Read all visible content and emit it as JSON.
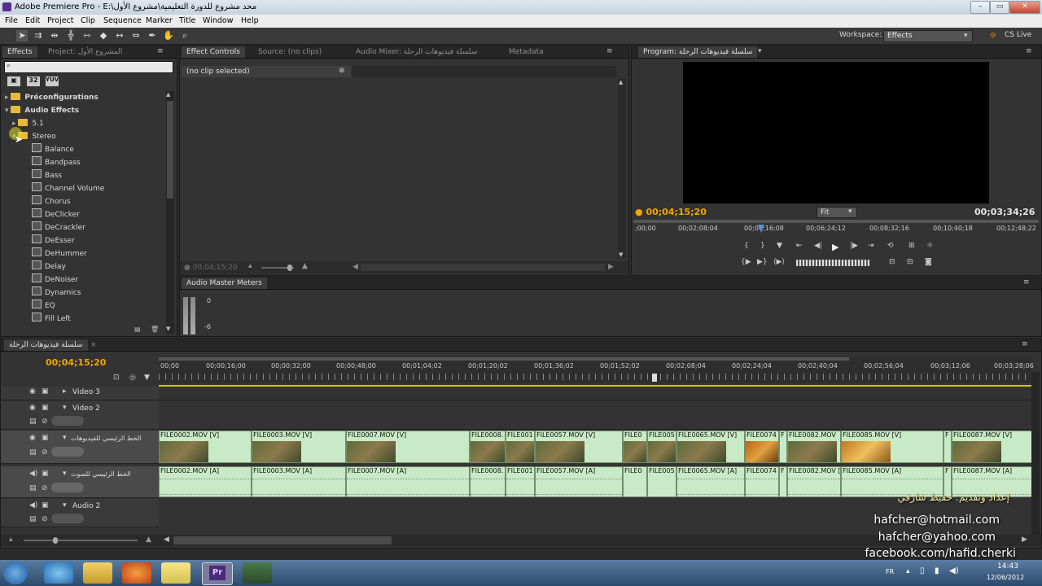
{
  "titlebar": {
    "title": "Adobe Premiere Pro - E:\\محد مشروع للدورة التعليمية\\مشروع الأول"
  },
  "menu": [
    "File",
    "Edit",
    "Project",
    "Clip",
    "Sequence",
    "Marker",
    "Title",
    "Window",
    "Help"
  ],
  "toolbar": {
    "workspace_label": "Workspace:",
    "workspace_value": "Effects",
    "cslive": "CS Live"
  },
  "effects_panel": {
    "tabs": [
      "Effects",
      "Project: المشروع الأول"
    ],
    "search_placeholder": "",
    "preset_buttons": [
      "▣",
      "32",
      "YUV"
    ],
    "tree": [
      {
        "label": "Préconfigurations",
        "type": "folder",
        "level": 0
      },
      {
        "label": "Audio Effects",
        "type": "folder",
        "level": 0
      },
      {
        "label": "5.1",
        "type": "folder",
        "level": 1
      },
      {
        "label": "Stereo",
        "type": "folder",
        "level": 1
      },
      {
        "label": "Balance",
        "type": "effect",
        "level": 2
      },
      {
        "label": "Bandpass",
        "type": "effect",
        "level": 2
      },
      {
        "label": "Bass",
        "type": "effect",
        "level": 2
      },
      {
        "label": "Channel Volume",
        "type": "effect",
        "level": 2
      },
      {
        "label": "Chorus",
        "type": "effect",
        "level": 2
      },
      {
        "label": "DeClicker",
        "type": "effect",
        "level": 2
      },
      {
        "label": "DeCrackler",
        "type": "effect",
        "level": 2
      },
      {
        "label": "DeEsser",
        "type": "effect",
        "level": 2
      },
      {
        "label": "DeHummer",
        "type": "effect",
        "level": 2
      },
      {
        "label": "Delay",
        "type": "effect",
        "level": 2
      },
      {
        "label": "DeNoiser",
        "type": "effect",
        "level": 2
      },
      {
        "label": "Dynamics",
        "type": "effect",
        "level": 2
      },
      {
        "label": "EQ",
        "type": "effect",
        "level": 2
      },
      {
        "label": "Fill Left",
        "type": "effect",
        "level": 2
      }
    ]
  },
  "effect_controls": {
    "tabs": [
      "Effect Controls",
      "Source: (no clips)",
      "Audio Mixer: سلسلة فيديوهات الرحلة",
      "Metadata"
    ],
    "no_clip": "(no clip selected)",
    "timecode": "00;04;15;20"
  },
  "meters": {
    "tab": "Audio Master Meters",
    "db0": "0",
    "db6": "-6"
  },
  "program": {
    "tab": "Program: سلسلة فيديوهات الرحلة",
    "timecode_left": "00;04;15;20",
    "fit": "Fit",
    "timecode_right": "00;03;34;26",
    "ruler": [
      ";00;00",
      "00;02;08;04",
      "00;04;16;08",
      "00;06;24;12",
      "00;08;32;16",
      "00;10;40;18",
      "00;12;48;22"
    ]
  },
  "timeline": {
    "tab": "سلسلة فيديوهات الرحلة",
    "timecode": "00;04;15;20",
    "ruler": [
      "00;00",
      "00;00;16;00",
      "00;00;32;00",
      "00;00;48;00",
      "00;01;04;02",
      "00;01;20;02",
      "00;01;36;02",
      "00;01;52;02",
      "00;02;08;04",
      "00;02;24;04",
      "00;02;40;04",
      "00;02;56;04",
      "00;03;12;06",
      "00;03;28;06"
    ],
    "tracks": {
      "video3": "Video 3",
      "video2": "Video 2",
      "video1": "الخط الرئيسي للفيديوهات",
      "audio1": "الخط الرئيسي للصوت",
      "audio2": "Audio 2"
    },
    "video_clips": [
      "FILE0002.MOV [V]",
      "FILE0003.MOV [V]",
      "FILE0007.MOV [V]",
      "FILE0008.",
      "FILE001",
      "FILE0057.MOV [V]",
      "FILE0",
      "FILE005",
      "FILE0065.MOV [V]",
      "FILE0074",
      "F",
      "FILE0082.MOV",
      "FILE0085.MOV [V]",
      "F",
      "FILE0087.MOV [V]"
    ],
    "audio_clips": [
      "FILE0002.MOV [A]",
      "FILE0003.MOV [A]",
      "FILE0007.MOV [A]",
      "FILE0008.",
      "FILE001",
      "FILE0057.MOV [A]",
      "FILE0",
      "FILE005",
      "FILE0065.MOV [A]",
      "FILE0074",
      "F",
      "FILE0082.MOV [A]",
      "FILE0085.MOV [A]",
      "F",
      "FILE0087.MOV [A]"
    ]
  },
  "watermark": {
    "line1": "إعداد وتقديم: حفيظ شارقي",
    "line2": "hafcher@hotmail.com",
    "line3": "hafcher@yahoo.com",
    "line4": "facebook.com/hafid.cherki"
  },
  "taskbar": {
    "lang": "FR",
    "time": "14:43",
    "date": "12/06/2012"
  }
}
